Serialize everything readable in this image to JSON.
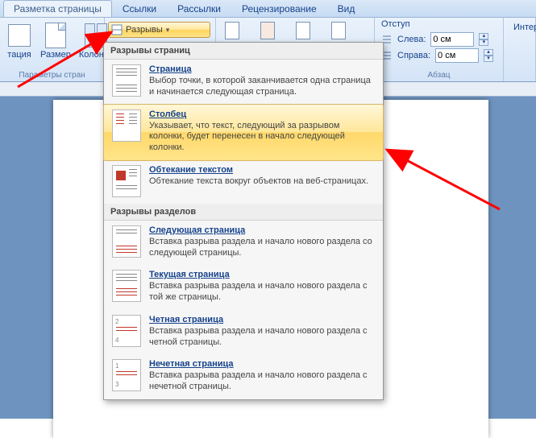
{
  "tabs": {
    "active": "Разметка страницы",
    "items": [
      "Разметка страницы",
      "Ссылки",
      "Рассылки",
      "Рецензирование",
      "Вид"
    ]
  },
  "ribbon": {
    "orientation": "тация",
    "size": "Размер",
    "columns": "Колонки",
    "breaks": "Разрывы",
    "group_page_setup": "Параметры стран",
    "indent_title": "Отступ",
    "left_label": "Слева:",
    "right_label": "Справа:",
    "left_value": "0 см",
    "right_value": "0 см",
    "group_paragraph": "Абзац",
    "inter_label": "Интер"
  },
  "dropdown": {
    "section_page": "Разрывы страниц",
    "section_sect": "Разрывы разделов",
    "items": [
      {
        "title": "Страница",
        "desc": "Выбор точки, в которой заканчивается одна страница и начинается следующая страница."
      },
      {
        "title": "Столбец",
        "desc": "Указывает, что текст, следующий за разрывом колонки, будет перенесен в начало следующей колонки.",
        "highlight": true
      },
      {
        "title": "Обтекание текстом",
        "desc": "Обтекание текста вокруг объектов на веб-страницах."
      },
      {
        "title": "Следующая страница",
        "desc": "Вставка разрыва раздела и начало нового раздела со следующей страницы."
      },
      {
        "title": "Текущая страница",
        "desc": "Вставка разрыва раздела и начало нового раздела с той же страницы."
      },
      {
        "title": "Четная страница",
        "desc": "Вставка разрыва раздела и начало нового раздела с четной страницы."
      },
      {
        "title": "Нечетная страница",
        "desc": "Вставка разрыва раздела и начало нового раздела с нечетной страницы."
      }
    ]
  }
}
